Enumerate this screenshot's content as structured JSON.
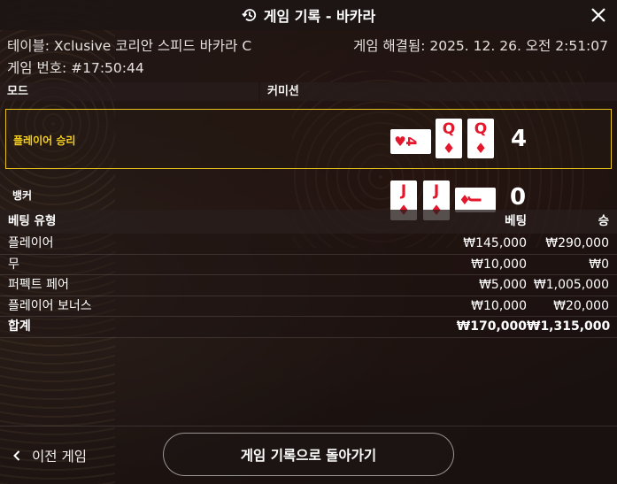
{
  "header": {
    "title": "게임 기록 - 바카라",
    "history_icon": "history-icon",
    "close_icon": "close-icon"
  },
  "info": {
    "table": "테이블: Xclusive 코리안 스피드 바카라 C",
    "game_number": "게임 번호: #17:50:44",
    "resolved": "게임 해결됨: 2025. 12. 26. 오전 2:51:07"
  },
  "mode": {
    "label": "모드",
    "value": "커미션"
  },
  "outcomes": {
    "player": {
      "label": "플레이어 승리",
      "cards": [
        {
          "rank": "4",
          "suit": "♥",
          "orientation": "sideways"
        },
        {
          "rank": "Q",
          "suit": "♦",
          "orientation": "upright"
        },
        {
          "rank": "Q",
          "suit": "♦",
          "orientation": "upright"
        }
      ],
      "score": "4"
    },
    "banker": {
      "label": "뱅커",
      "cards": [
        {
          "rank": "J",
          "suit": "♦",
          "orientation": "upright"
        },
        {
          "rank": "J",
          "suit": "♦",
          "orientation": "upright"
        },
        {
          "rank": "J",
          "suit": "♦",
          "orientation": "sideways"
        }
      ],
      "score": "0"
    }
  },
  "bets": {
    "headers": {
      "type": "베팅 유형",
      "bet": "베팅",
      "win": "승"
    },
    "rows": [
      {
        "type": "플레이어",
        "bet": "₩145,000",
        "win": "₩290,000"
      },
      {
        "type": "무",
        "bet": "₩10,000",
        "win": "₩0"
      },
      {
        "type": "퍼펙트 페어",
        "bet": "₩5,000",
        "win": "₩1,005,000"
      },
      {
        "type": "플레이어 보너스",
        "bet": "₩10,000",
        "win": "₩20,000"
      }
    ],
    "total": {
      "type": "합계",
      "bet": "₩170,000",
      "win": "₩1,315,000"
    }
  },
  "footer": {
    "prev_label": "이전 게임",
    "back_label": "게임 기록으로 돌아가기"
  },
  "colors": {
    "winner_highlight": "#e9c31b",
    "card_red": "#e4162b"
  }
}
